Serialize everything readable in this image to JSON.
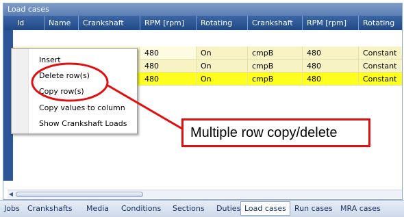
{
  "panel": {
    "title": "Load cases"
  },
  "columns": [
    "Id",
    "Name",
    "Crankshaft",
    "RPM [rpm]",
    "Rotating",
    "Crankshaft",
    "RPM [rpm]",
    "Rotating"
  ],
  "rows": [
    {
      "rpm1": "480",
      "rot1": "On",
      "crank2": "cmpB",
      "rpm2": "480",
      "rot2": "Constant"
    },
    {
      "rpm1": "480",
      "rot1": "On",
      "crank2": "cmpB",
      "rpm2": "480",
      "rot2": "Constant"
    },
    {
      "rpm1": "480",
      "rot1": "On",
      "crank2": "cmpB",
      "rpm2": "480",
      "rot2": "Constant"
    }
  ],
  "context_menu": {
    "items": [
      "Insert",
      "Delete row(s)",
      "Copy row(s)",
      "Copy values to column",
      "Show Crankshaft Loads"
    ]
  },
  "callout": {
    "text": "Multiple row copy/delete"
  },
  "tabs": [
    "Jobs",
    "Crankshafts",
    "Media",
    "Conditions",
    "Sections",
    "Duties",
    "Load cases",
    "Run cases",
    "MRA cases"
  ],
  "active_tab": "Load cases",
  "colors": {
    "header": "#2a5293",
    "row_light": "#f7f3c4",
    "row_highlight": "#ffff1e",
    "callout_border": "#e01010"
  }
}
